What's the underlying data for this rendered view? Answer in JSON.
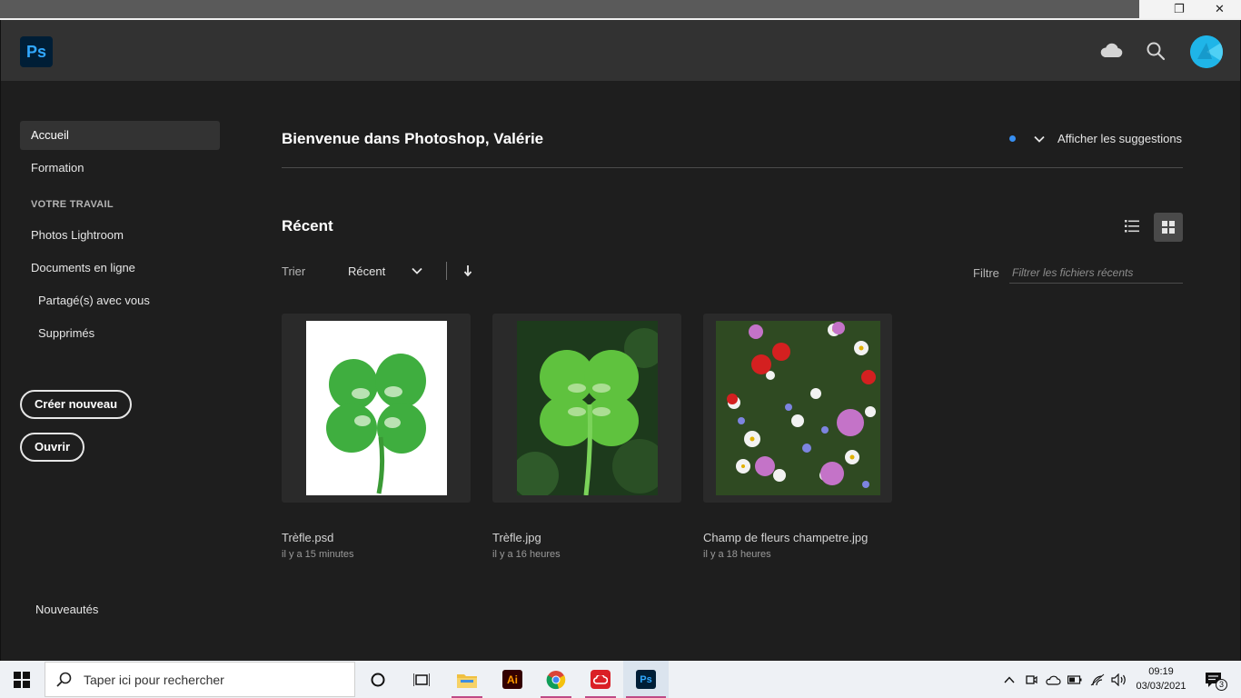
{
  "window": {
    "restore_glyph": "❐",
    "close_glyph": "✕"
  },
  "header": {
    "app_logo": "Ps",
    "icons": [
      "cloud-icon",
      "search-icon",
      "avatar"
    ]
  },
  "sidebar": {
    "items": [
      {
        "label": "Accueil",
        "active": true
      },
      {
        "label": "Formation"
      }
    ],
    "section_label": "VOTRE TRAVAIL",
    "work_items": [
      {
        "label": "Photos Lightroom"
      },
      {
        "label": "Documents en ligne"
      },
      {
        "label": "Partagé(s) avec vous",
        "indent": true
      },
      {
        "label": "Supprimés",
        "indent": true
      }
    ],
    "create_button": "Créer nouveau",
    "open_button": "Ouvrir",
    "whats_new": "Nouveautés"
  },
  "main": {
    "welcome": "Bienvenue dans Photoshop, Valérie",
    "suggestions_label": "Afficher les suggestions",
    "recent_title": "Récent",
    "sort_label": "Trier",
    "sort_value": "Récent",
    "filter_label": "Filtre",
    "filter_placeholder": "Filtrer les fichiers récents",
    "files": [
      {
        "name": "Trèfle.psd",
        "date": "il y a 15 minutes"
      },
      {
        "name": "Trèfle.jpg",
        "date": "il y a 16 heures"
      },
      {
        "name": "Champ de fleurs champetre.jpg",
        "date": "il y a 18 heures"
      }
    ]
  },
  "taskbar": {
    "search_placeholder": "Taper ici pour rechercher",
    "time": "09:19",
    "date": "03/03/2021",
    "notification_count": "3",
    "accent_color": "#c04a86"
  }
}
